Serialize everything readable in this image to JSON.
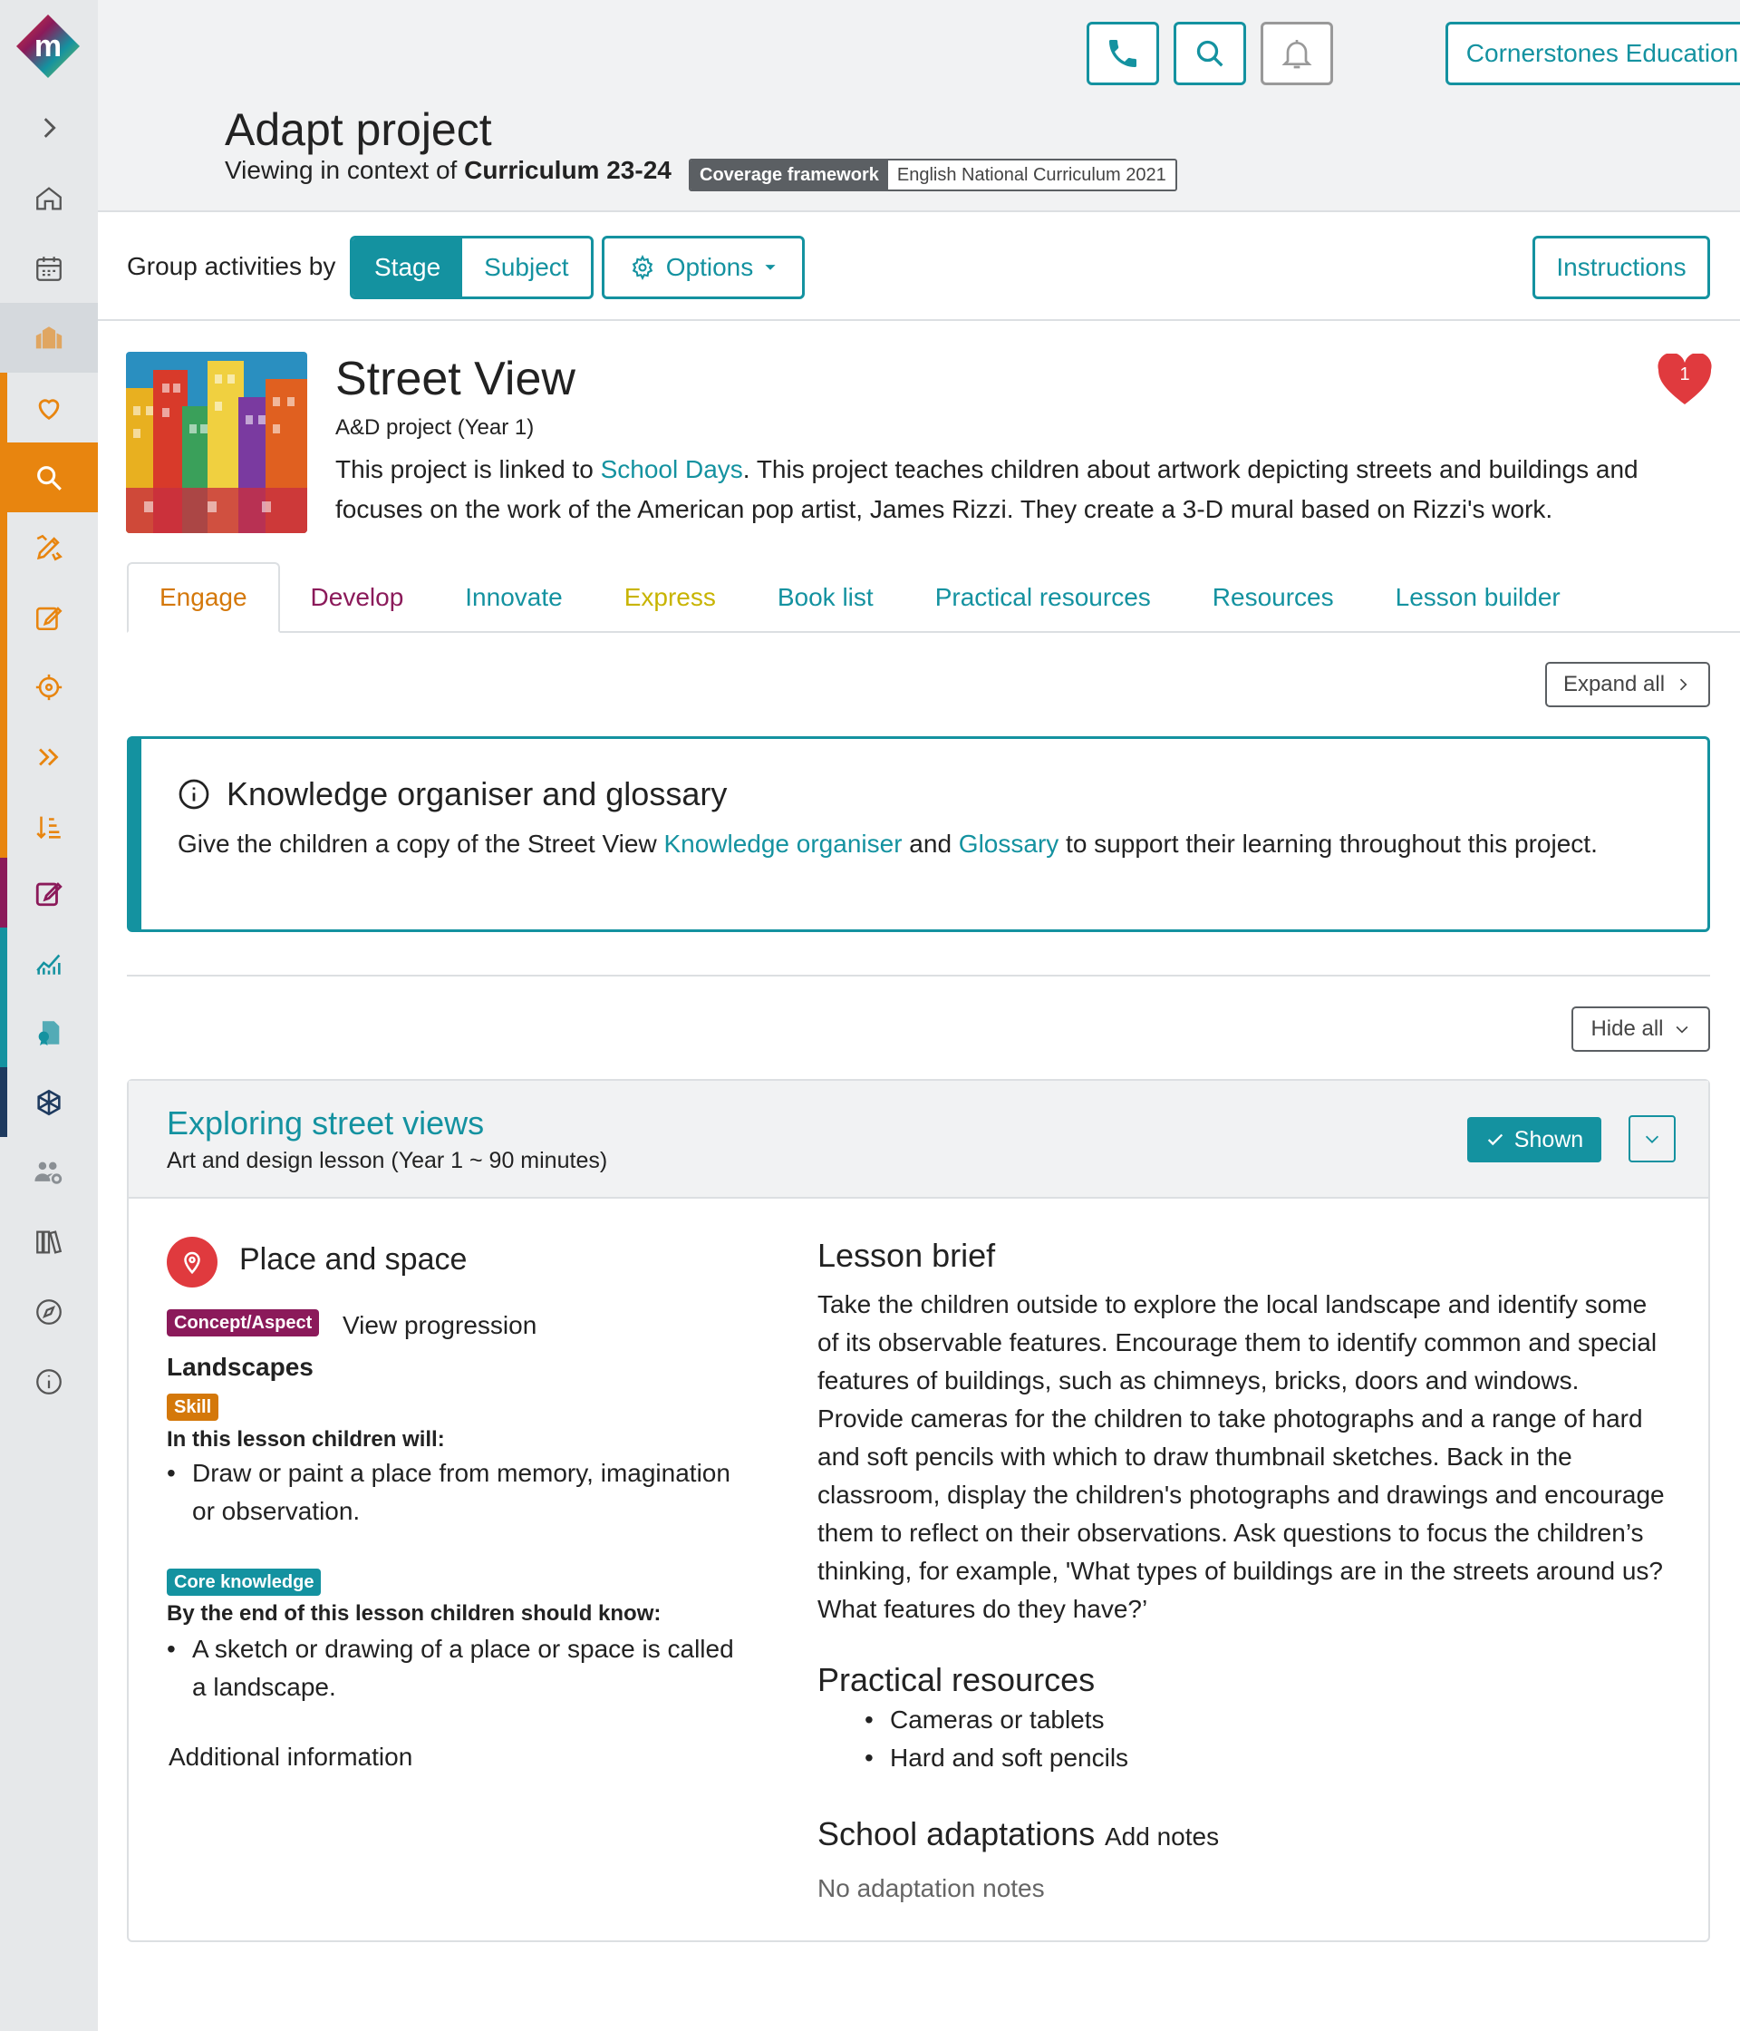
{
  "header": {
    "school_name": "Cornerstones Education",
    "page_title": "Adapt project",
    "context_prefix": "Viewing in context of",
    "context_value": "Curriculum 23-24",
    "coverage_key": "Coverage framework",
    "coverage_value": "English National Curriculum 2021"
  },
  "toolbar": {
    "group_label": "Group activities by",
    "stage": "Stage",
    "subject": "Subject",
    "options": "Options",
    "instructions": "Instructions"
  },
  "project": {
    "title": "Street View",
    "subtitle": "A&D project (Year 1)",
    "desc_before_link": "This project is linked to ",
    "desc_link": "School Days",
    "desc_after_link": ". This project teaches children about artwork depicting streets and buildings and focuses on the work of the American pop artist, James Rizzi. They create a 3-D mural based on Rizzi's work.",
    "favourite_count": "1"
  },
  "tabs": [
    {
      "label": "Engage",
      "color": "#d4780a"
    },
    {
      "label": "Develop",
      "color": "#8b1a5a"
    },
    {
      "label": "Innovate",
      "color": "#1492a0"
    },
    {
      "label": "Express",
      "color": "#c8b400"
    },
    {
      "label": "Book list",
      "color": "#1492a0"
    },
    {
      "label": "Practical resources",
      "color": "#1492a0"
    },
    {
      "label": "Resources",
      "color": "#1492a0"
    },
    {
      "label": "Lesson builder",
      "color": "#1492a0"
    }
  ],
  "expand_all": "Expand all",
  "hide_all": "Hide all",
  "knowledge": {
    "title": "Knowledge organiser and glossary",
    "text_before": "Give the children a copy of the Street View ",
    "link1": "Knowledge organiser",
    "text_mid": " and ",
    "link2": "Glossary",
    "text_after": " to support their learning throughout this project."
  },
  "lesson": {
    "title": "Exploring street views",
    "subtitle": "Art and design lesson (Year 1 ~ 90 minutes)",
    "shown": "Shown",
    "place_space": "Place and space",
    "concept_badge": "Concept/Aspect",
    "view_progression": "View progression",
    "landscapes": "Landscapes",
    "skill_badge": "Skill",
    "will_label": "In this lesson children will:",
    "will_item": "Draw or paint a place from memory, imagination or observation.",
    "core_badge": "Core knowledge",
    "know_label": "By the end of this lesson children should know:",
    "know_item": "A sketch or drawing of a place or space is called a landscape.",
    "additional": "Additional information",
    "brief_title": "Lesson brief",
    "brief_text": "Take the children outside to explore the local landscape and identify some of its observable features. Encourage them to identify common and special features of buildings, such as chimneys, bricks, doors and windows. Provide cameras for the children to take photographs and a range of hard and soft pencils with which to draw thumbnail sketches. Back in the classroom, display the children's photographs and drawings and encourage them to reflect on their observations. Ask questions to focus the children’s thinking, for example, 'What types of buildings are in the streets around us? What features do they have?’",
    "resources_title": "Practical resources",
    "resources": [
      "Cameras or tablets",
      "Hard and soft pencils"
    ],
    "adaptations_title": "School adaptations",
    "add_notes": "Add notes",
    "no_notes": "No adaptation notes"
  },
  "colors": {
    "accent": "#1492a0",
    "orange": "#e8850f",
    "concept": "#8b1a5a",
    "skill": "#d4780a",
    "heart": "#e03a3e"
  }
}
